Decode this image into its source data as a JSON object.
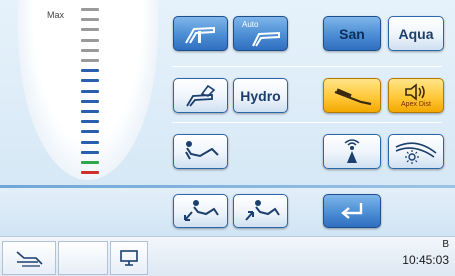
{
  "gauge": {
    "max_label": "Max",
    "tick_colors": [
      "#9a9a9a",
      "#9a9a9a",
      "#9a9a9a",
      "#9a9a9a",
      "#9a9a9a",
      "#9a9a9a",
      "#2a5fb0",
      "#2a5fb0",
      "#2a5fb0",
      "#2a5fb0",
      "#2a5fb0",
      "#2a5fb0",
      "#2a5fb0",
      "#2a5fb0",
      "#2a5fb0",
      "#2fa84a",
      "#d0302a"
    ]
  },
  "buttons": {
    "auto_label": "Auto",
    "san_label": "San",
    "aqua_label": "Aqua",
    "hydro_label": "Hydro",
    "apex_label": "Apex Dist"
  },
  "status": {
    "indicator": "B",
    "time": "10:45:03"
  },
  "colors": {
    "accent_blue": "#2f6fbf",
    "accent_yellow": "#ffc83a",
    "divider": "#6fa6d6"
  },
  "icons": [
    "handpiece-icon",
    "auto-handpiece-icon",
    "scaler-icon",
    "speaker-icon",
    "chair-recline-icon",
    "light-sensor-icon",
    "lamp-icon",
    "chair-down-icon",
    "chair-up-icon",
    "return-arrow-icon",
    "chair-status-icon",
    "monitor-icon"
  ]
}
